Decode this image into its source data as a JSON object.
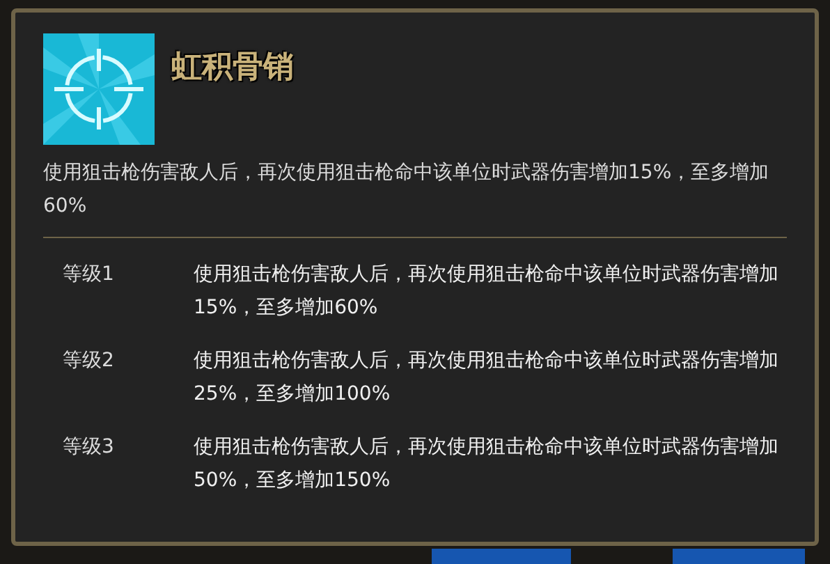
{
  "skill": {
    "title": "虹积骨销",
    "description": "使用狙击枪伤害敌人后，再次使用狙击枪命中该单位时武器伤害增加15%，至多增加60%"
  },
  "levels": [
    {
      "label": "等级1",
      "text": "使用狙击枪伤害敌人后，再次使用狙击枪命中该单位时武器伤害增加15%，至多增加60%"
    },
    {
      "label": "等级2",
      "text": "使用狙击枪伤害敌人后，再次使用狙击枪命中该单位时武器伤害增加25%，至多增加100%"
    },
    {
      "label": "等级3",
      "text": "使用狙击枪伤害敌人后，再次使用狙击枪命中该单位时武器伤害增加50%，至多增加150%"
    }
  ]
}
